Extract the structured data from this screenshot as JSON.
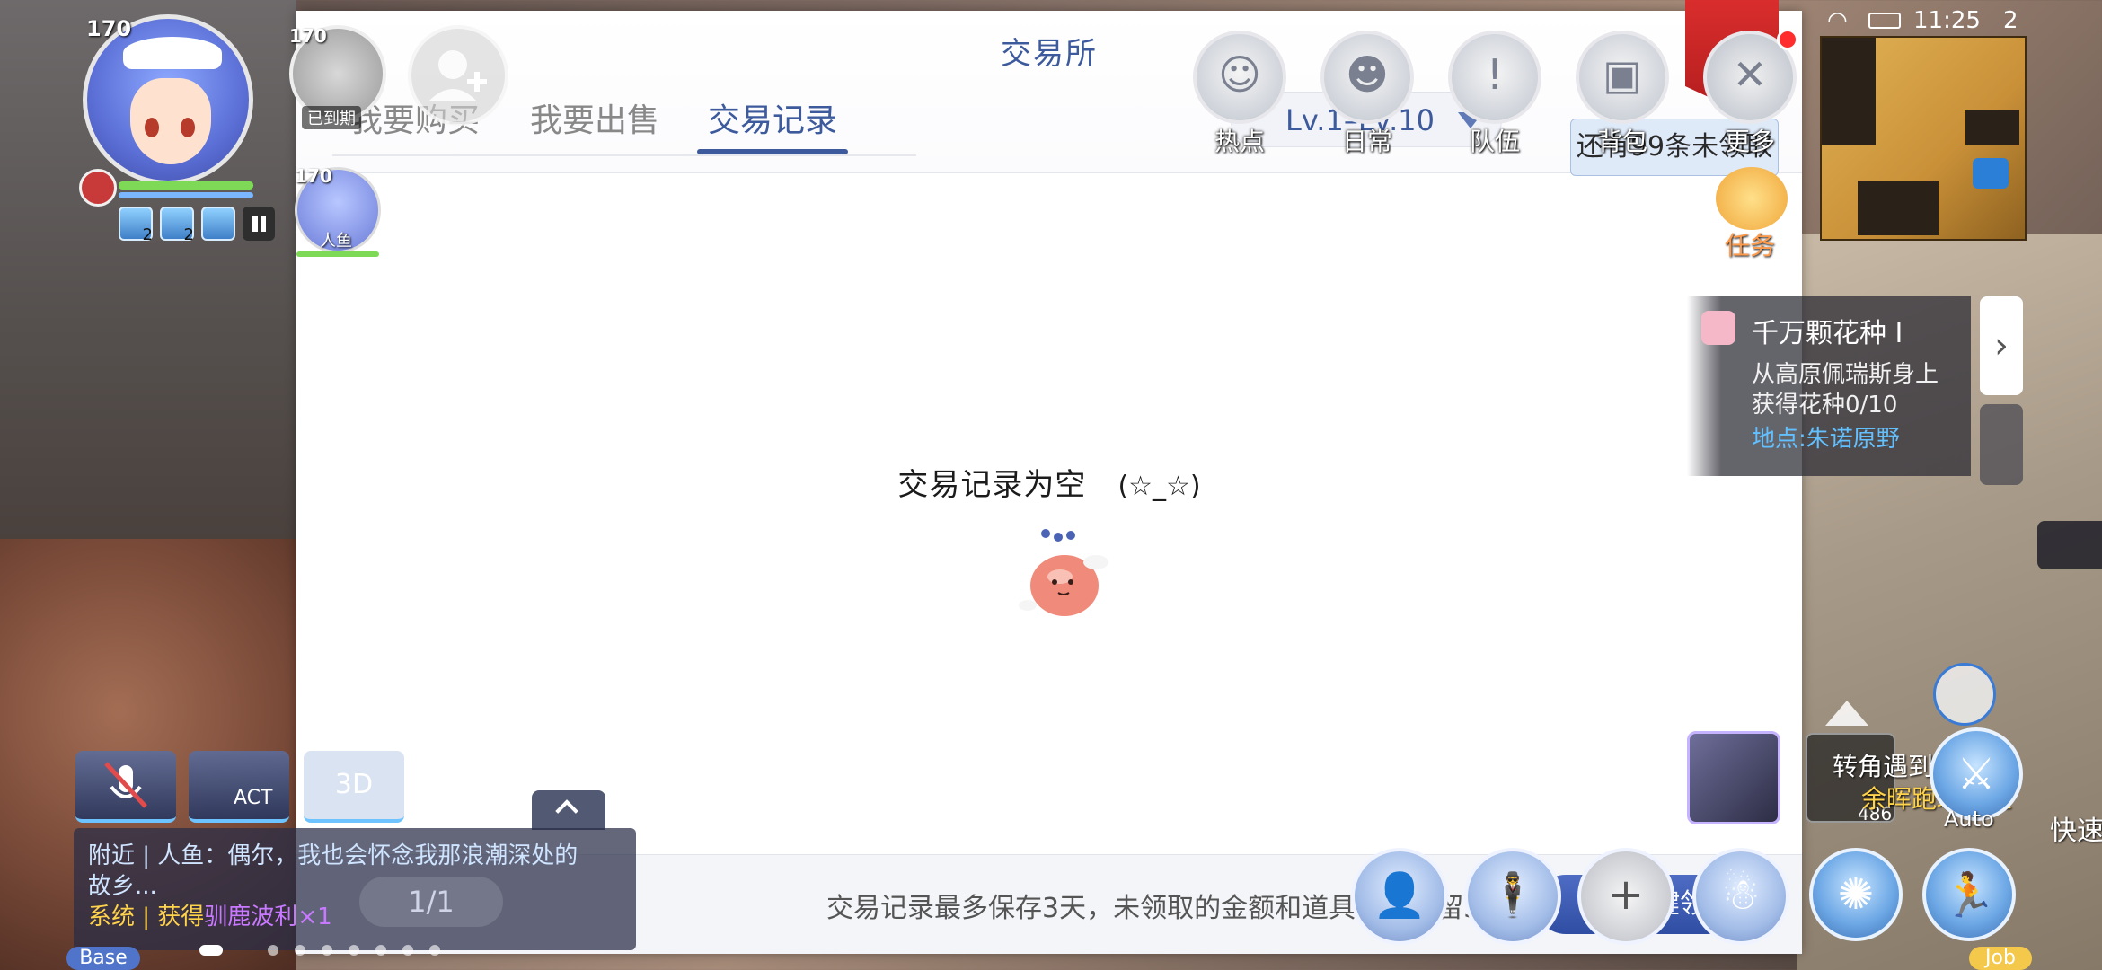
{
  "statusbar": {
    "time": "11:25",
    "count": "2"
  },
  "player": {
    "level": "170"
  },
  "pet": {
    "level": "170",
    "status": "已到期"
  },
  "companion": {
    "level": "170",
    "name": "人鱼"
  },
  "buffs": [
    {
      "count": "2"
    },
    {
      "count": "2"
    }
  ],
  "panel": {
    "title": "交易所",
    "tabs": [
      {
        "label": "我要购买"
      },
      {
        "label": "我要出售"
      },
      {
        "label": "交易记录",
        "active": true
      }
    ],
    "level_filter": "Lv.1–Lv.10",
    "unclaimed": "还有99条未领取",
    "empty_text": "交易记录为空",
    "empty_face": "(☆_☆)",
    "footer_text": "交易记录最多保存3天，未领取的金额和道具最多保留3",
    "claim_button": "一键领取"
  },
  "menu": [
    {
      "label": "热点",
      "icon": "hotspot-icon"
    },
    {
      "label": "日常",
      "icon": "daily-icon"
    },
    {
      "label": "队伍",
      "icon": "team-icon"
    },
    {
      "label": "背包",
      "icon": "backpack-icon"
    },
    {
      "label": "更多",
      "icon": "more-icon"
    }
  ],
  "task": {
    "label": "任务"
  },
  "quest": {
    "title": "千万颗花种 I",
    "line1": "从高原佩瑞斯身上",
    "line2": "获得花种0/10",
    "location_label": "地点:",
    "location": "朱诺原野"
  },
  "right_hud": {
    "event_line1": "转角遇到爱的门",
    "event_line2": "余晖跑环专业",
    "item_count": "486",
    "auto_label": "Auto",
    "quick_wash": "快速洗",
    "job_label": "Job"
  },
  "chat": {
    "line1_channel": "附近 | 人鱼：",
    "line1_text": "偶尔，我也会怀念我那浪潮深处的",
    "line2_text": "故乡...",
    "line3_channel": "系统 | 获得",
    "line3_item": "驯鹿波利",
    "line3_qty": "×1",
    "pager": "1/1",
    "act_label": "ACT",
    "three_d_label": "3D"
  },
  "base_label": "Base",
  "colors": {
    "accent": "#3d5a9c",
    "claim": "#2f4ea3",
    "quest_location": "#63c0ff",
    "task": "#ff9a4a"
  }
}
